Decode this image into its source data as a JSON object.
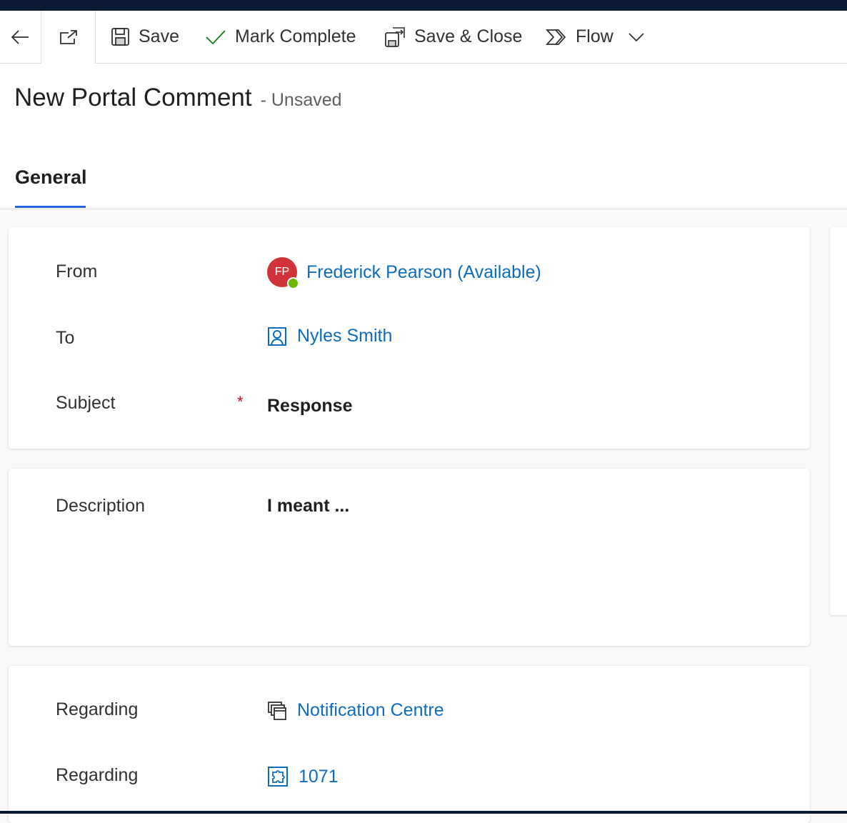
{
  "toolbar": {
    "back_icon": "arrow-left-icon",
    "popout_icon": "open-in-new-window-icon",
    "save_label": "Save",
    "mark_complete_label": "Mark Complete",
    "save_close_label": "Save & Close",
    "flow_label": "Flow"
  },
  "header": {
    "title": "New Portal Comment",
    "status": "- Unsaved",
    "tabs": [
      {
        "label": "General",
        "selected": true
      }
    ]
  },
  "form": {
    "from": {
      "label": "From",
      "avatar_initials": "FP",
      "value": "Frederick Pearson (Available)"
    },
    "to": {
      "label": "To",
      "value": "Nyles Smith"
    },
    "subject": {
      "label": "Subject",
      "required_mark": "*",
      "value": "Response"
    },
    "description": {
      "label": "Description",
      "value": "I meant ..."
    },
    "regarding1": {
      "label": "Regarding",
      "value": "Notification Centre"
    },
    "regarding2": {
      "label": "Regarding",
      "value": "1071"
    }
  },
  "colors": {
    "accent": "#2266e3",
    "link": "#0f6cbd",
    "avatar": "#d13438",
    "presence_available": "#6bb700",
    "required": "#c50f1f",
    "topbar": "#0b1a33"
  }
}
